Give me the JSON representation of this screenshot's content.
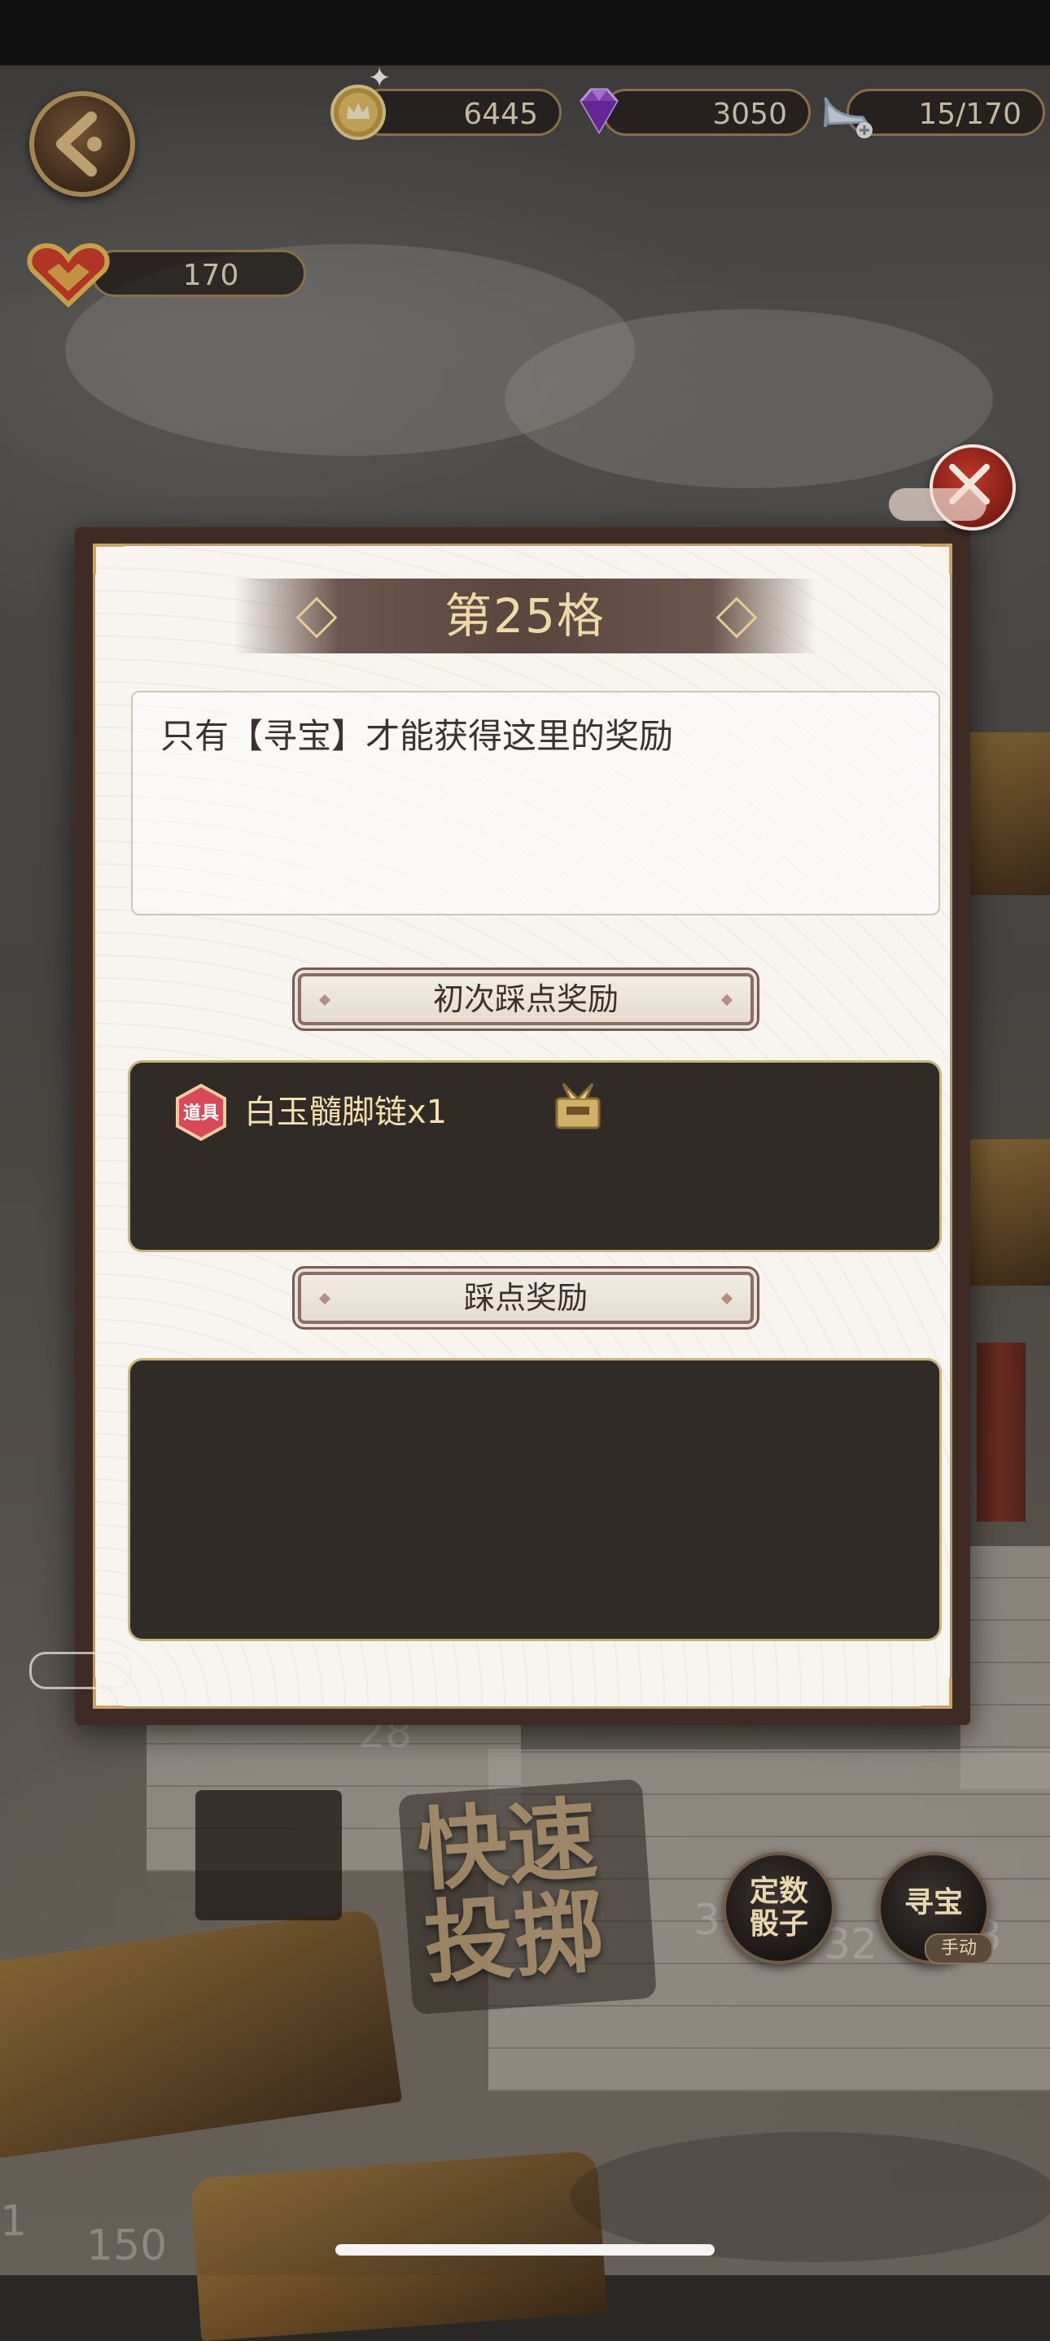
{
  "hud": {
    "coins": "6445",
    "gems": "3050",
    "shoe": "15/170",
    "hearts": "170"
  },
  "modal": {
    "title": "第25格",
    "description": "只有【寻宝】才能获得这里的奖励",
    "first_visit_label": "初次踩点奖励",
    "first_visit_rewards": [
      {
        "badge": "道具",
        "name": "白玉髓脚链x1"
      }
    ],
    "visit_label": "踩点奖励",
    "visit_rewards": []
  },
  "controls": {
    "quick_roll_line1": "快速",
    "quick_roll_line2": "投掷",
    "fixed_dice_line1": "定数",
    "fixed_dice_line2": "骰子",
    "treasure_hunt": "寻宝",
    "manual": "手动"
  },
  "board_numbers": {
    "n28": "28",
    "n3": "3",
    "n32": "32",
    "n3b": "3",
    "n150": "150",
    "n1": "1"
  },
  "colors": {
    "accent_gold": "#c9a468",
    "panel_dark": "#312b28",
    "title_text": "#f0d9a8"
  }
}
